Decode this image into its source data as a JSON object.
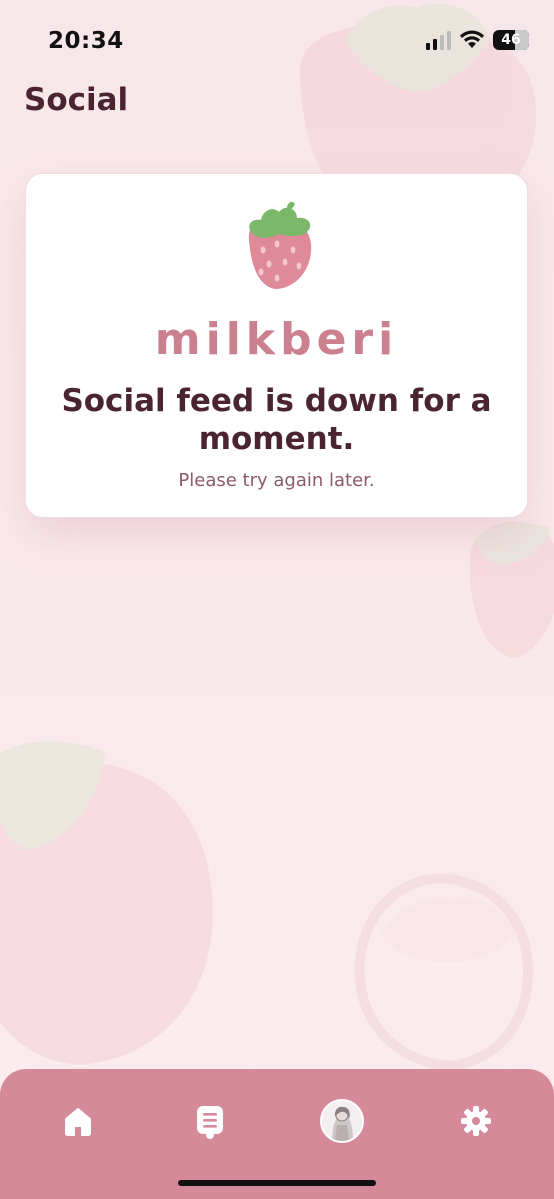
{
  "status_bar": {
    "time": "20:34",
    "battery_level": "46",
    "signal_bars_active": 2,
    "signal_bars_total": 4
  },
  "header": {
    "title": "Social"
  },
  "error_card": {
    "brand": "milkberi",
    "title": "Social feed is down for a moment.",
    "subtitle": "Please try again later."
  },
  "tab_bar": {
    "active_tab": "feed",
    "tabs": [
      {
        "name": "home",
        "icon": "home-icon"
      },
      {
        "name": "feed",
        "icon": "feed-list-icon"
      },
      {
        "name": "profile",
        "icon": "avatar"
      },
      {
        "name": "settings",
        "icon": "gear-icon"
      }
    ]
  },
  "colors": {
    "background": "#f9e8eb",
    "accent": "#d48a99",
    "title_text": "#4a2430",
    "brand_text": "#cb808f",
    "subtitle_text": "#8b5a6b"
  }
}
